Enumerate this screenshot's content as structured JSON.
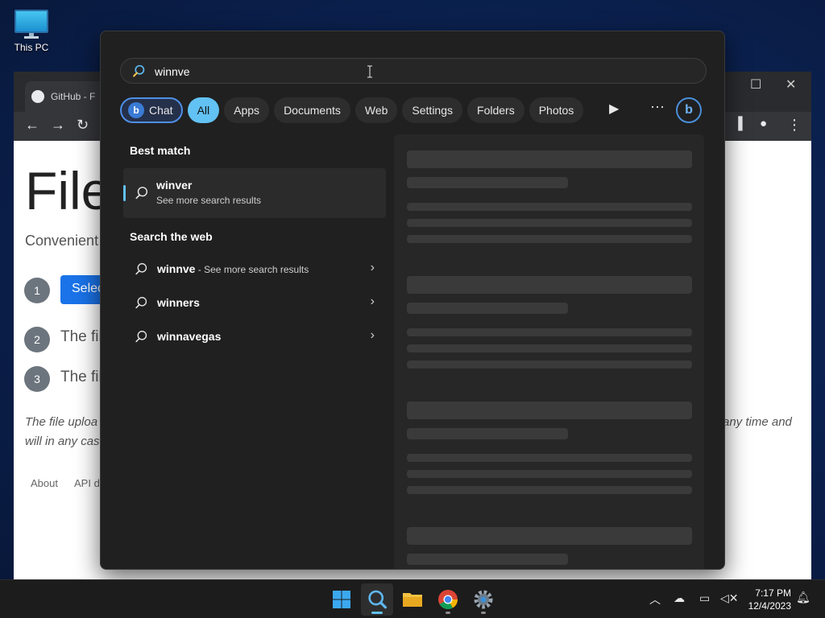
{
  "desktop": {
    "this_pc_label": "This PC"
  },
  "browser": {
    "tab_title": "GitHub - F",
    "heading": "File",
    "subheading": "Convenient",
    "steps": [
      {
        "num": "1",
        "text": "Selec"
      },
      {
        "num": "2",
        "text": "The fil"
      },
      {
        "num": "3",
        "text": "The fil"
      }
    ],
    "select_button": "Selec",
    "italic_left_1": "The file uploa",
    "italic_left_2": "will in any cas",
    "italic_right": "any time and",
    "footer_links": [
      "About",
      "API d"
    ]
  },
  "search": {
    "query": "winnve",
    "chips": [
      {
        "label": "Chat"
      },
      {
        "label": "All"
      },
      {
        "label": "Apps"
      },
      {
        "label": "Documents"
      },
      {
        "label": "Web"
      },
      {
        "label": "Settings"
      },
      {
        "label": "Folders"
      },
      {
        "label": "Photos"
      }
    ],
    "best_match_title": "Best match",
    "best_match": {
      "title": "winver",
      "subtitle": "See more search results"
    },
    "web_title": "Search the web",
    "web_results": [
      {
        "term": "winnve",
        "more": " - See more search results"
      },
      {
        "term": "winners",
        "more": ""
      },
      {
        "term": "winnavegas",
        "more": ""
      }
    ]
  },
  "taskbar": {
    "time": "7:17 PM",
    "date": "12/4/2023"
  },
  "colors": {
    "accent": "#62c2f3",
    "panel": "#202020",
    "taskbar": "#1c1c1c"
  }
}
